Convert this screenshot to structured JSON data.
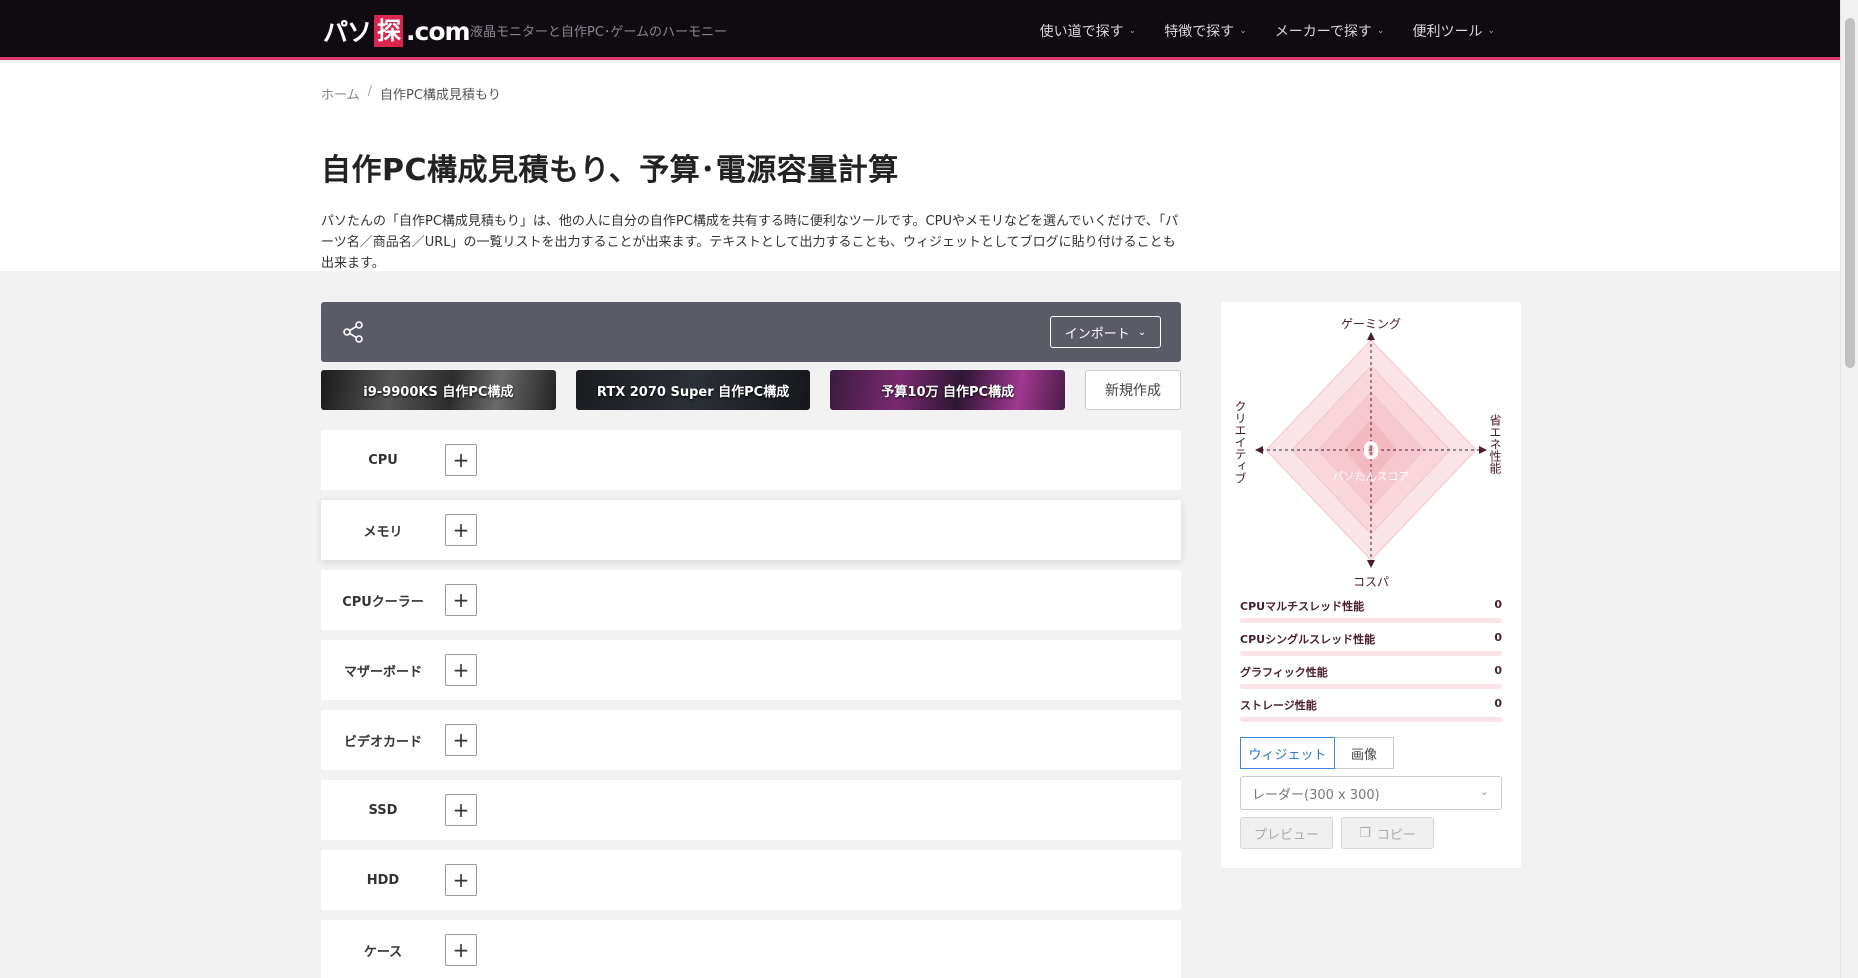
{
  "header": {
    "logo_pre": "パソ",
    "logo_kanji": "探",
    "logo_post": ".com",
    "tagline": "液晶モニターと自作PC･ゲームのハーモニー",
    "nav": [
      "使い道で探す",
      "特徴で探す",
      "メーカーで探す",
      "便利ツール"
    ]
  },
  "breadcrumb": {
    "home": "ホーム",
    "sep": "/",
    "current": "自作PC構成見積もり"
  },
  "page": {
    "title": "自作PC構成見積もり、予算･電源容量計算",
    "intro": "パソたんの「自作PC構成見積もり」は、他の人に自分の自作PC構成を共有する時に便利なツールです。CPUやメモリなどを選んでいくだけで、「パーツ名／商品名／URL」の一覧リストを出力することが出来ます。テキストとして出力することも、ウィジェットとしてブログに貼り付けることも出来ます。"
  },
  "builder": {
    "import_label": "インポート",
    "presets": [
      "i9-9900KS 自作PC構成",
      "RTX 2070 Super 自作PC構成",
      "予算10万 自作PC構成"
    ],
    "new_label": "新規作成",
    "parts": [
      "CPU",
      "メモリ",
      "CPUクーラー",
      "マザーボード",
      "ビデオカード",
      "SSD",
      "HDD",
      "ケース"
    ],
    "add_symbol": "+"
  },
  "score": {
    "axis_top": "ゲーミング",
    "axis_bottom": "コスパ",
    "axis_left": "クリエイティブ",
    "axis_right": "省エネ性能",
    "value": "0",
    "label": "パソたんスコア",
    "stats": [
      {
        "label": "CPUマルチスレッド性能",
        "value": "0"
      },
      {
        "label": "CPUシングルスレッド性能",
        "value": "0"
      },
      {
        "label": "グラフィック性能",
        "value": "0"
      },
      {
        "label": "ストレージ性能",
        "value": "0"
      }
    ],
    "tabs": [
      "ウィジェット",
      "画像"
    ],
    "select_value": "レーダー(300 x 300)",
    "preview_label": "プレビュー",
    "copy_label": "コピー"
  },
  "colors": {
    "accent": "#d63a6e",
    "header_bg": "#0f0b10",
    "toolbar_bg": "#5b5b67",
    "tab_active": "#3d8be0"
  }
}
